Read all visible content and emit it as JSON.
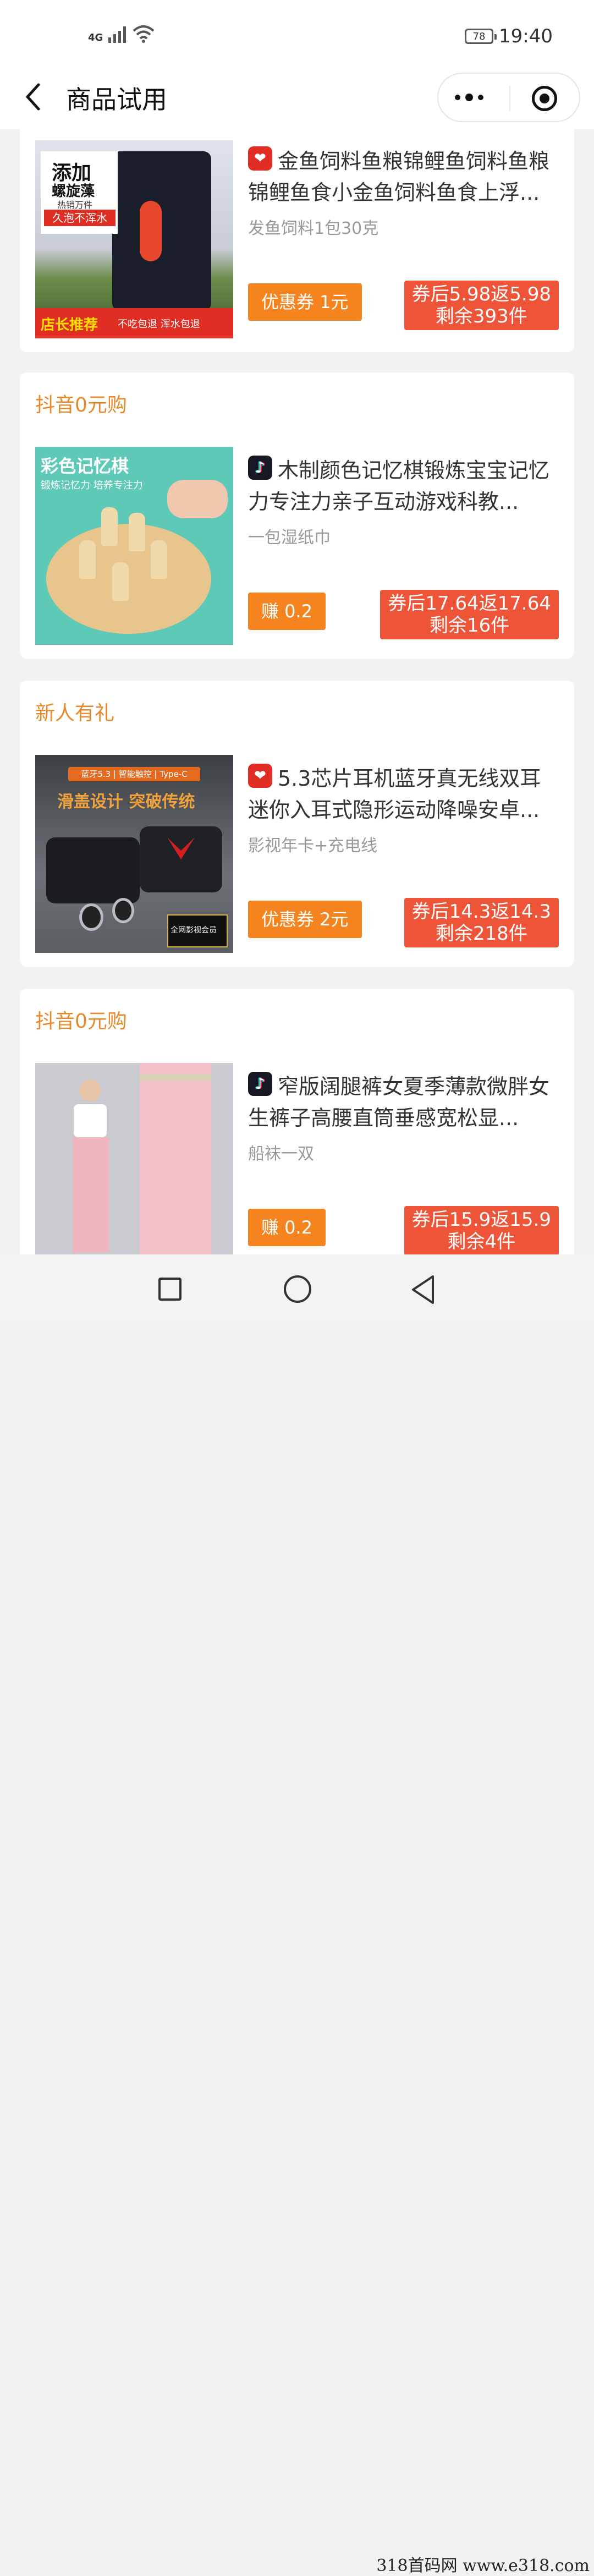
{
  "status": {
    "network": "4G",
    "battery": "78",
    "time": "19:40"
  },
  "nav": {
    "title": "商品试用"
  },
  "products": [
    {
      "tag": "",
      "platform": "pinduoduo",
      "title": "金鱼饲料鱼粮锦鲤鱼饲料鱼粮锦鲤鱼食小金鱼饲料鱼食上浮...",
      "subtitle": "发鱼饲料1包30克",
      "coupon": "优惠券  1元",
      "price_line1": "券后5.98返5.98",
      "price_line2": "剩余393件",
      "image": {
        "text1": "添加",
        "text2": "螺旋藻",
        "text3": "热销万件",
        "text4": "久泡不浑水",
        "text5": "店长推荐",
        "text6": "不吃包退 浑水包退"
      }
    },
    {
      "tag": "抖音0元购",
      "platform": "douyin",
      "title": "木制颜色记忆棋锻炼宝宝记忆力专注力亲子互动游戏科教...",
      "subtitle": "一包湿纸巾",
      "coupon": "赚  0.2",
      "price_line1": "券后17.64返17.64",
      "price_line2": "剩余16件",
      "image": {
        "text1": "彩色记忆棋",
        "text2": "锻炼记忆力 培养专注力"
      }
    },
    {
      "tag": "新人有礼",
      "platform": "pinduoduo",
      "title": "5.3芯片耳机蓝牙真无线双耳迷你入耳式隐形运动降噪安卓...",
      "subtitle": "影视年卡+充电线",
      "coupon": "优惠券  2元",
      "price_line1": "券后14.3返14.3",
      "price_line2": "剩余218件",
      "image": {
        "text1": "蓝牙5.3 | 智能触控 | Type-C",
        "text2": "滑盖设计  突破传统",
        "text3": "全网影视会员"
      }
    },
    {
      "tag": "抖音0元购",
      "platform": "douyin",
      "title": "窄版阔腿裤女夏季薄款微胖女生裤子高腰直筒垂感宽松显...",
      "subtitle": "船袜一双",
      "coupon": "赚  0.2",
      "price_line1": "券后15.9返15.9",
      "price_line2": "剩余4件",
      "image": {}
    }
  ],
  "watermark": "318首码网  www.e318.com"
}
